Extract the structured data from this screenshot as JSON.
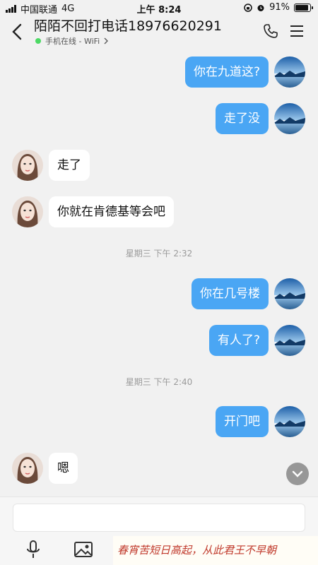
{
  "status_bar": {
    "carrier": "中国联通",
    "network": "4G",
    "time": "上午 8:24",
    "battery": "91%",
    "battery_level": 0.91
  },
  "header": {
    "title": "陌陌不回打电话18976620291",
    "status": "手机在线 - WiFi",
    "status_color": "#4cd964"
  },
  "messages": [
    {
      "type": "out",
      "text": "你在九道这?"
    },
    {
      "type": "out",
      "text": "走了没"
    },
    {
      "type": "in",
      "text": "走了"
    },
    {
      "type": "in",
      "text": "你就在肯德基等会吧"
    },
    {
      "type": "time",
      "text": "星期三 下午 2:32"
    },
    {
      "type": "out",
      "text": "你在几号楼"
    },
    {
      "type": "out",
      "text": "有人了?"
    },
    {
      "type": "time",
      "text": "星期三 下午 2:40"
    },
    {
      "type": "out",
      "text": "开门吧"
    },
    {
      "type": "in",
      "text": "嗯"
    }
  ],
  "input": {
    "placeholder": ""
  },
  "overlay_text": "春宵苦短日高起，从此君王不早朝",
  "colors": {
    "out_bubble": "#4aa6f4",
    "in_bubble": "#ffffff",
    "background": "#f1f1f1"
  }
}
